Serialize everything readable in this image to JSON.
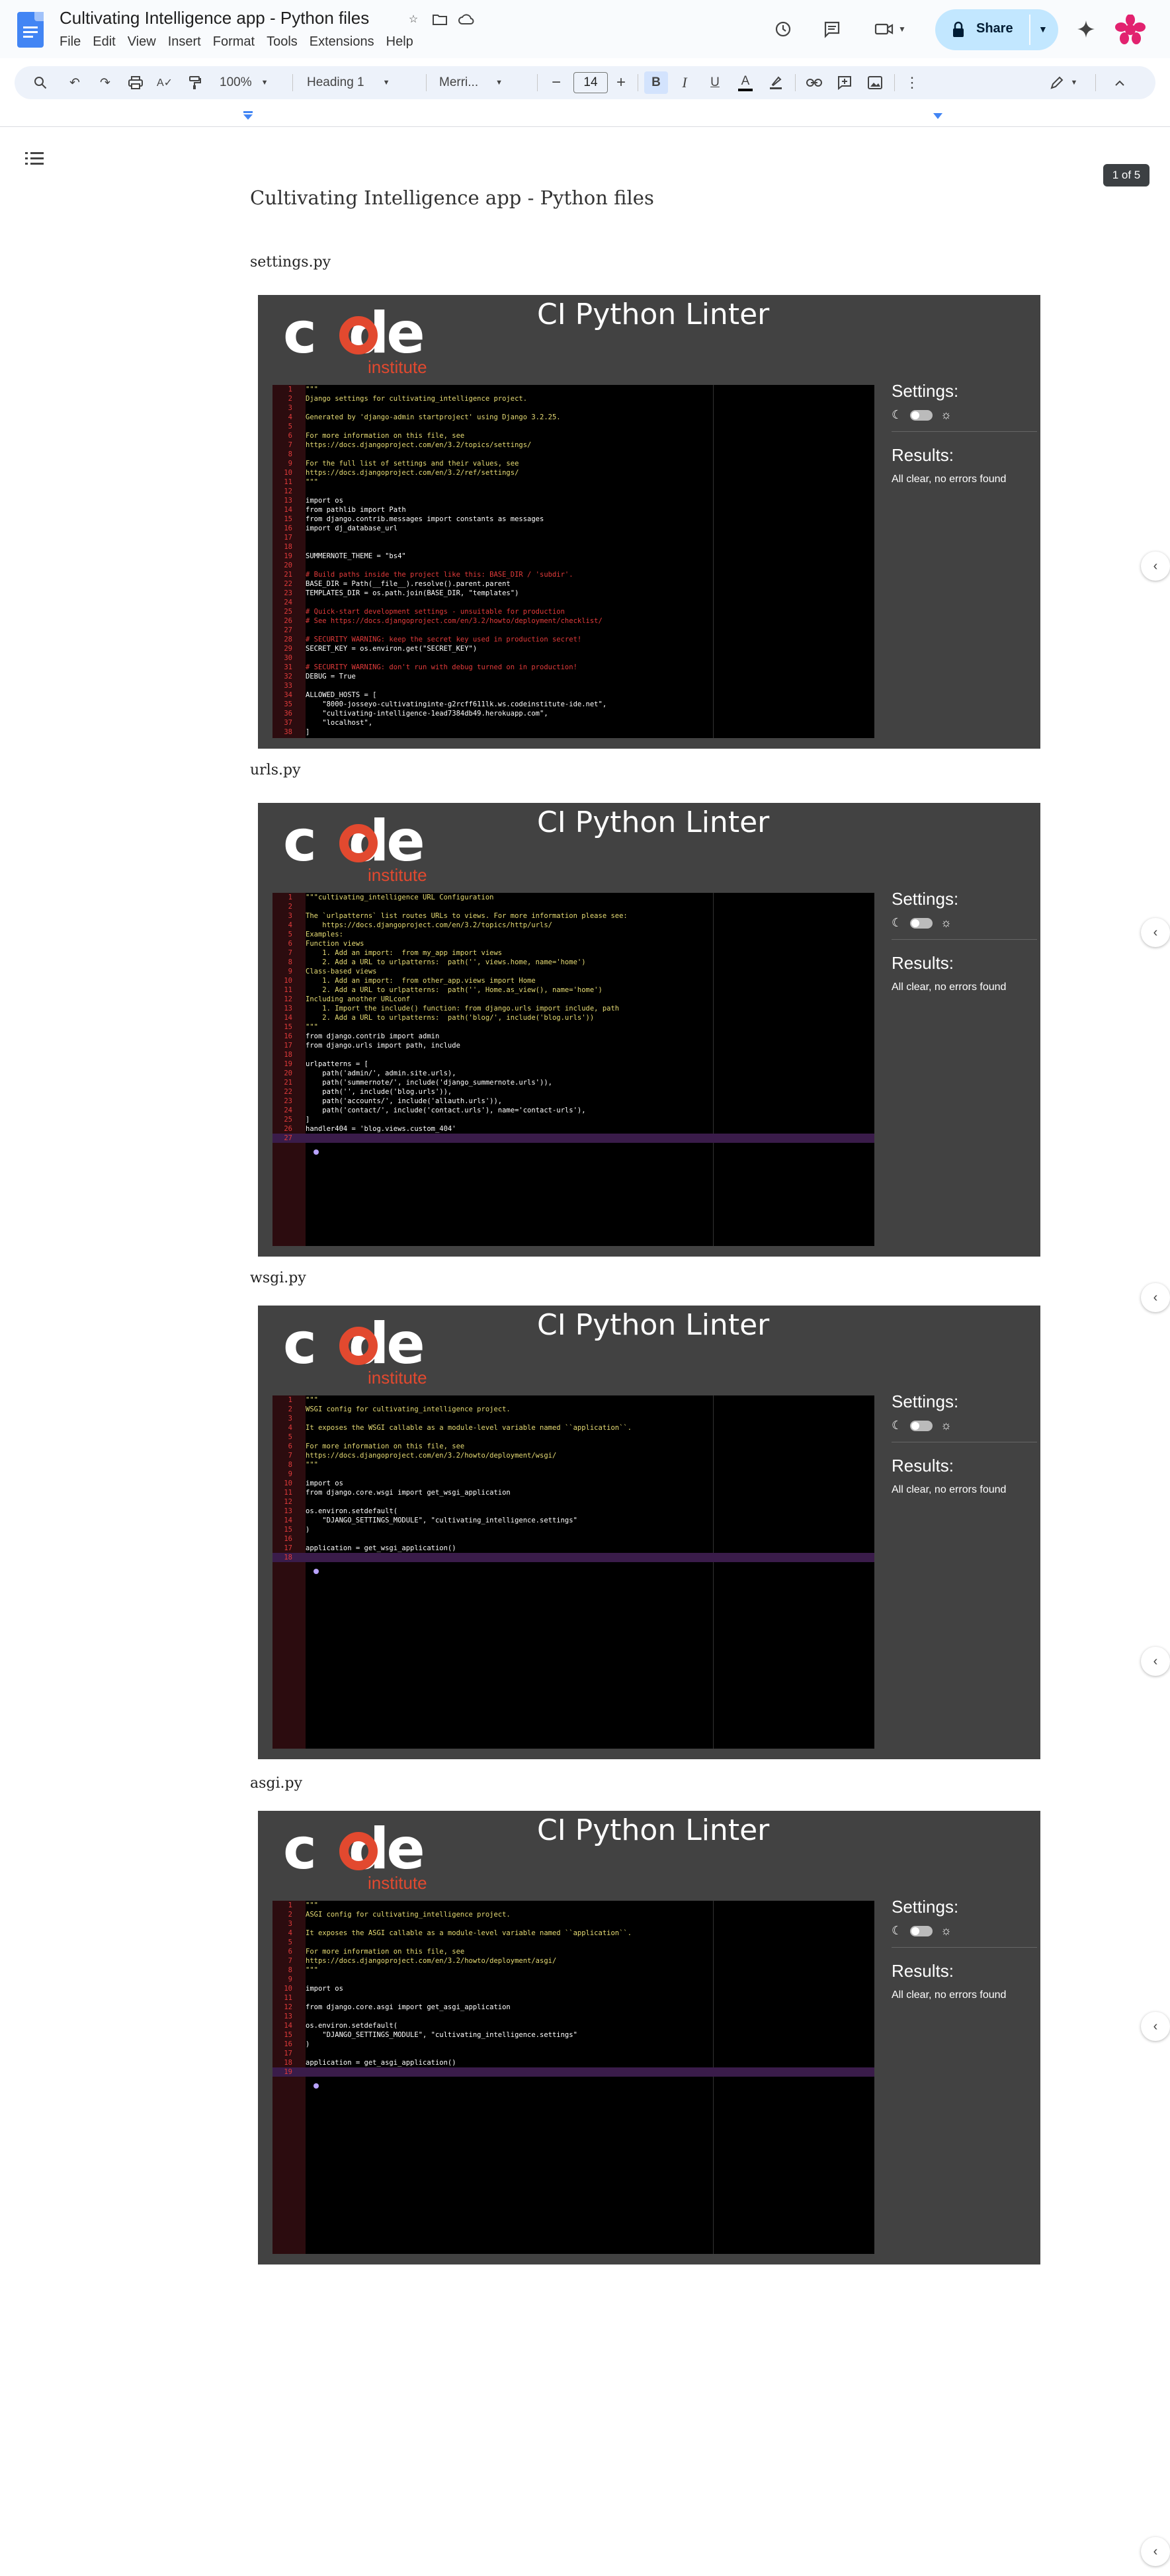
{
  "app": {
    "doc_title": "Cultivating Intelligence app - Python files",
    "menu": [
      "File",
      "Edit",
      "View",
      "Insert",
      "Format",
      "Tools",
      "Extensions",
      "Help"
    ],
    "share_label": "Share",
    "accent_color": "#c2e7ff"
  },
  "toolbar": {
    "zoom": "100%",
    "style": "Heading 1",
    "font": "Merri...",
    "font_size": "14",
    "bold": "B",
    "italic": "I",
    "underline": "U",
    "text_color": "A"
  },
  "page_badge": "1 of 5",
  "document": {
    "heading": "Cultivating Intelligence app - Python files",
    "sections": [
      {
        "filename": "settings.py",
        "linter_title": "CI Python Linter",
        "settings_label": "Settings:",
        "results_label": "Results:",
        "results_value": "All clear, no errors found",
        "code": [
          {
            "n": "1",
            "t": "\"\"\"",
            "k": "str"
          },
          {
            "n": "2",
            "t": "Django settings for cultivating_intelligence project.",
            "k": "str"
          },
          {
            "n": "3",
            "t": "",
            "k": ""
          },
          {
            "n": "4",
            "t": "Generated by 'django-admin startproject' using Django 3.2.25.",
            "k": "str"
          },
          {
            "n": "5",
            "t": "",
            "k": ""
          },
          {
            "n": "6",
            "t": "For more information on this file, see",
            "k": "str"
          },
          {
            "n": "7",
            "t": "https://docs.djangoproject.com/en/3.2/topics/settings/",
            "k": "str"
          },
          {
            "n": "8",
            "t": "",
            "k": ""
          },
          {
            "n": "9",
            "t": "For the full list of settings and their values, see",
            "k": "str"
          },
          {
            "n": "10",
            "t": "https://docs.djangoproject.com/en/3.2/ref/settings/",
            "k": "str"
          },
          {
            "n": "11",
            "t": "\"\"\"",
            "k": "str"
          },
          {
            "n": "12",
            "t": "",
            "k": ""
          },
          {
            "n": "13",
            "t": "import os",
            "k": ""
          },
          {
            "n": "14",
            "t": "from pathlib import Path",
            "k": ""
          },
          {
            "n": "15",
            "t": "from django.contrib.messages import constants as messages",
            "k": ""
          },
          {
            "n": "16",
            "t": "import dj_database_url",
            "k": ""
          },
          {
            "n": "17",
            "t": "",
            "k": ""
          },
          {
            "n": "18",
            "t": "",
            "k": ""
          },
          {
            "n": "19",
            "t": "SUMMERNOTE_THEME = \"bs4\"",
            "k": ""
          },
          {
            "n": "20",
            "t": "",
            "k": ""
          },
          {
            "n": "21",
            "t": "# Build paths inside the project like this: BASE_DIR / 'subdir'.",
            "k": "com"
          },
          {
            "n": "22",
            "t": "BASE_DIR = Path(__file__).resolve().parent.parent",
            "k": ""
          },
          {
            "n": "23",
            "t": "TEMPLATES_DIR = os.path.join(BASE_DIR, \"templates\")",
            "k": ""
          },
          {
            "n": "24",
            "t": "",
            "k": ""
          },
          {
            "n": "25",
            "t": "# Quick-start development settings - unsuitable for production",
            "k": "com"
          },
          {
            "n": "26",
            "t": "# See https://docs.djangoproject.com/en/3.2/howto/deployment/checklist/",
            "k": "com"
          },
          {
            "n": "27",
            "t": "",
            "k": ""
          },
          {
            "n": "28",
            "t": "# SECURITY WARNING: keep the secret key used in production secret!",
            "k": "com"
          },
          {
            "n": "29",
            "t": "SECRET_KEY = os.environ.get(\"SECRET_KEY\")",
            "k": ""
          },
          {
            "n": "30",
            "t": "",
            "k": ""
          },
          {
            "n": "31",
            "t": "# SECURITY WARNING: don't run with debug turned on in production!",
            "k": "com"
          },
          {
            "n": "32",
            "t": "DEBUG = True",
            "k": ""
          },
          {
            "n": "33",
            "t": "",
            "k": ""
          },
          {
            "n": "34",
            "t": "ALLOWED_HOSTS = [",
            "k": ""
          },
          {
            "n": "35",
            "t": "    \"8000-josseyo-cultivatinginte-g2rcff611lk.ws.codeinstitute-ide.net\",",
            "k": ""
          },
          {
            "n": "36",
            "t": "    \"cultivating-intelligence-1ead7384db49.herokuapp.com\",",
            "k": ""
          },
          {
            "n": "37",
            "t": "    \"localhost\",",
            "k": ""
          },
          {
            "n": "38",
            "t": "]",
            "k": ""
          }
        ]
      },
      {
        "filename": "urls.py",
        "linter_title": "CI Python Linter",
        "settings_label": "Settings:",
        "results_label": "Results:",
        "results_value": "All clear, no errors found",
        "code": [
          {
            "n": "1",
            "t": "\"\"\"cultivating_intelligence URL Configuration",
            "k": "str"
          },
          {
            "n": "2",
            "t": "",
            "k": ""
          },
          {
            "n": "3",
            "t": "The `urlpatterns` list routes URLs to views. For more information please see:",
            "k": "str"
          },
          {
            "n": "4",
            "t": "    https://docs.djangoproject.com/en/3.2/topics/http/urls/",
            "k": "str"
          },
          {
            "n": "5",
            "t": "Examples:",
            "k": "str"
          },
          {
            "n": "6",
            "t": "Function views",
            "k": "str"
          },
          {
            "n": "7",
            "t": "    1. Add an import:  from my_app import views",
            "k": "str"
          },
          {
            "n": "8",
            "t": "    2. Add a URL to urlpatterns:  path('', views.home, name='home')",
            "k": "str"
          },
          {
            "n": "9",
            "t": "Class-based views",
            "k": "str"
          },
          {
            "n": "10",
            "t": "    1. Add an import:  from other_app.views import Home",
            "k": "str"
          },
          {
            "n": "11",
            "t": "    2. Add a URL to urlpatterns:  path('', Home.as_view(), name='home')",
            "k": "str"
          },
          {
            "n": "12",
            "t": "Including another URLconf",
            "k": "str"
          },
          {
            "n": "13",
            "t": "    1. Import the include() function: from django.urls import include, path",
            "k": "str"
          },
          {
            "n": "14",
            "t": "    2. Add a URL to urlpatterns:  path('blog/', include('blog.urls'))",
            "k": "str"
          },
          {
            "n": "15",
            "t": "\"\"\"",
            "k": "str"
          },
          {
            "n": "16",
            "t": "from django.contrib import admin",
            "k": ""
          },
          {
            "n": "17",
            "t": "from django.urls import path, include",
            "k": ""
          },
          {
            "n": "18",
            "t": "",
            "k": ""
          },
          {
            "n": "19",
            "t": "urlpatterns = [",
            "k": ""
          },
          {
            "n": "20",
            "t": "    path('admin/', admin.site.urls),",
            "k": ""
          },
          {
            "n": "21",
            "t": "    path('summernote/', include('django_summernote.urls')),",
            "k": ""
          },
          {
            "n": "22",
            "t": "    path('', include('blog.urls')),",
            "k": ""
          },
          {
            "n": "23",
            "t": "    path('accounts/', include('allauth.urls')),",
            "k": ""
          },
          {
            "n": "24",
            "t": "    path('contact/', include('contact.urls'), name='contact-urls'),",
            "k": ""
          },
          {
            "n": "25",
            "t": "]",
            "k": ""
          },
          {
            "n": "26",
            "t": "handler404 = 'blog.views.custom_404'",
            "k": ""
          },
          {
            "n": "27",
            "t": "",
            "k": "cursor"
          }
        ]
      },
      {
        "filename": "wsgi.py",
        "linter_title": "CI Python Linter",
        "settings_label": "Settings:",
        "results_label": "Results:",
        "results_value": "All clear, no errors found",
        "code": [
          {
            "n": "1",
            "t": "\"\"\"",
            "k": "str"
          },
          {
            "n": "2",
            "t": "WSGI config for cultivating_intelligence project.",
            "k": "str"
          },
          {
            "n": "3",
            "t": "",
            "k": ""
          },
          {
            "n": "4",
            "t": "It exposes the WSGI callable as a module-level variable named ``application``.",
            "k": "str"
          },
          {
            "n": "5",
            "t": "",
            "k": ""
          },
          {
            "n": "6",
            "t": "For more information on this file, see",
            "k": "str"
          },
          {
            "n": "7",
            "t": "https://docs.djangoproject.com/en/3.2/howto/deployment/wsgi/",
            "k": "str"
          },
          {
            "n": "8",
            "t": "\"\"\"",
            "k": "str"
          },
          {
            "n": "9",
            "t": "",
            "k": ""
          },
          {
            "n": "10",
            "t": "import os",
            "k": ""
          },
          {
            "n": "11",
            "t": "from django.core.wsgi import get_wsgi_application",
            "k": ""
          },
          {
            "n": "12",
            "t": "",
            "k": ""
          },
          {
            "n": "13",
            "t": "os.environ.setdefault(",
            "k": ""
          },
          {
            "n": "14",
            "t": "    \"DJANGO_SETTINGS_MODULE\", \"cultivating_intelligence.settings\"",
            "k": ""
          },
          {
            "n": "15",
            "t": ")",
            "k": ""
          },
          {
            "n": "16",
            "t": "",
            "k": ""
          },
          {
            "n": "17",
            "t": "application = get_wsgi_application()",
            "k": ""
          },
          {
            "n": "18",
            "t": "",
            "k": "cursor"
          }
        ]
      },
      {
        "filename": "asgi.py",
        "linter_title": "CI Python Linter",
        "settings_label": "Settings:",
        "results_label": "Results:",
        "results_value": "All clear, no errors found",
        "code": [
          {
            "n": "1",
            "t": "\"\"\"",
            "k": "str"
          },
          {
            "n": "2",
            "t": "ASGI config for cultivating_intelligence project.",
            "k": "str"
          },
          {
            "n": "3",
            "t": "",
            "k": ""
          },
          {
            "n": "4",
            "t": "It exposes the ASGI callable as a module-level variable named ``application``.",
            "k": "str"
          },
          {
            "n": "5",
            "t": "",
            "k": ""
          },
          {
            "n": "6",
            "t": "For more information on this file, see",
            "k": "str"
          },
          {
            "n": "7",
            "t": "https://docs.djangoproject.com/en/3.2/howto/deployment/asgi/",
            "k": "str"
          },
          {
            "n": "8",
            "t": "\"\"\"",
            "k": "str"
          },
          {
            "n": "9",
            "t": "",
            "k": ""
          },
          {
            "n": "10",
            "t": "import os",
            "k": ""
          },
          {
            "n": "11",
            "t": "",
            "k": ""
          },
          {
            "n": "12",
            "t": "from django.core.asgi import get_asgi_application",
            "k": ""
          },
          {
            "n": "13",
            "t": "",
            "k": ""
          },
          {
            "n": "14",
            "t": "os.environ.setdefault(",
            "k": ""
          },
          {
            "n": "15",
            "t": "    \"DJANGO_SETTINGS_MODULE\", \"cultivating_intelligence.settings\"",
            "k": ""
          },
          {
            "n": "16",
            "t": ")",
            "k": ""
          },
          {
            "n": "17",
            "t": "",
            "k": ""
          },
          {
            "n": "18",
            "t": "application = get_asgi_application()",
            "k": ""
          },
          {
            "n": "19",
            "t": "",
            "k": "cursor"
          }
        ]
      }
    ]
  },
  "logo": {
    "word": "c de",
    "sub": "institute"
  }
}
